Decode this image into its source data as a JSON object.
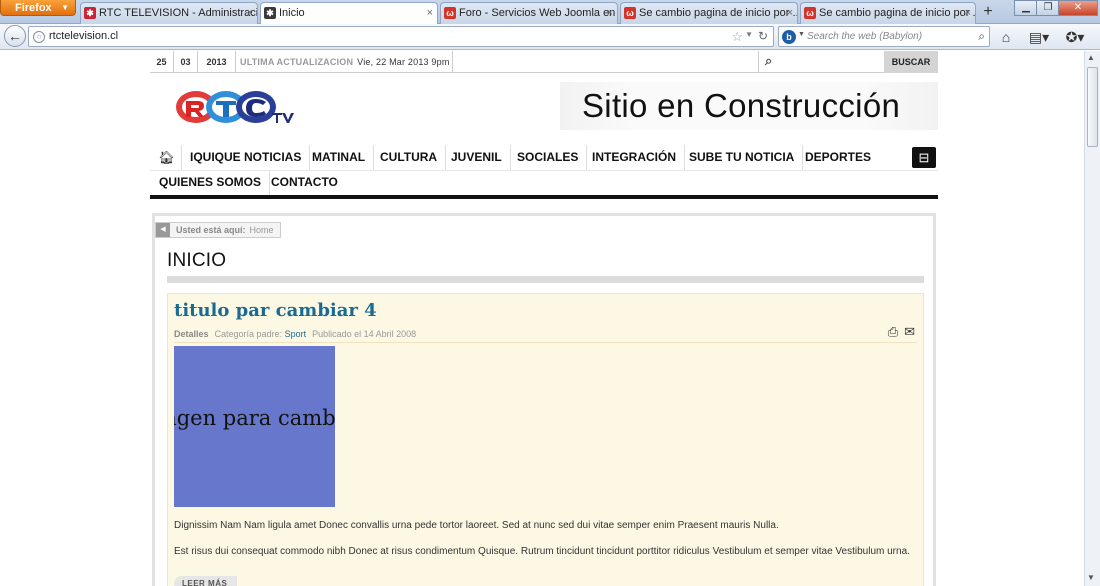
{
  "browser": {
    "app_button": "Firefox",
    "tabs": [
      {
        "title": "RTC TELEVISION - Administración",
        "active": false
      },
      {
        "title": "Inicio",
        "active": true
      },
      {
        "title": "Foro - Servicios Web Joomla en ...",
        "active": false
      },
      {
        "title": "Se cambio pagina de inicio por ...",
        "active": false
      },
      {
        "title": "Se cambio pagina de inicio por ...",
        "active": false
      }
    ],
    "url": "rtctelevision.cl",
    "search_placeholder": "Search the web (Babylon)"
  },
  "site": {
    "date": {
      "day": "25",
      "month": "03",
      "year": "2013"
    },
    "last_update_label": "ULTIMA ACTUALIZACION",
    "last_update_value": "Vie, 22 Mar 2013 9pm",
    "search_button": "BUSCAR",
    "banner_text": "Sitio en Construcción",
    "nav": {
      "row1": [
        "IQUIQUE NOTICIAS",
        "MATINAL",
        "CULTURA",
        "JUVENIL",
        "SOCIALES",
        "INTEGRACIÓN",
        "SUBE TU NOTICIA",
        "DEPORTES"
      ],
      "row2": [
        "QUIENES SOMOS",
        "CONTACTO"
      ]
    },
    "breadcrumb": {
      "label": "Usted está aquí:",
      "home": "Home"
    },
    "page_title": "INICIO",
    "article": {
      "title": "titulo par cambiar 4",
      "details_label": "Detalles",
      "category_label": "Categoría padre:",
      "category": "Sport",
      "published": "Publicado el 14 Abril 2008",
      "image_caption": "Imagen para cambiar",
      "paragraphs": [
        "Dignissim Nam Nam ligula amet Donec convallis urna pede tortor laoreet. Sed at nunc sed dui vitae semper enim Praesent mauris Nulla.",
        "Est risus dui consequat commodo nibh Donec at risus condimentum Quisque. Rutrum tincidunt tincidunt porttitor ridiculus Vestibulum et semper vitae Vestibulum urna."
      ],
      "read_more": "LEER MÁS"
    }
  },
  "colors": {
    "article_bg": "#fdf8e4",
    "title_blue": "#1a6b93",
    "image_bg": "#6677cc",
    "nav_rule": "#111111"
  }
}
